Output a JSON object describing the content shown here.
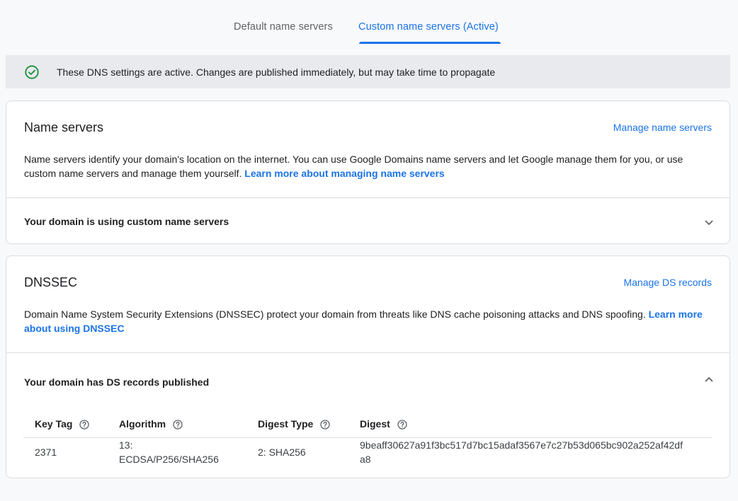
{
  "tabs": [
    {
      "label": "Default name servers"
    },
    {
      "label": "Custom name servers (Active)"
    }
  ],
  "banner": {
    "icon": "check-circle-icon",
    "color": "#1e8e3e",
    "message": "These DNS settings are active. Changes are published immediately, but may take time to propagate"
  },
  "name_servers": {
    "title": "Name servers",
    "manage_link": "Manage name servers",
    "description": "Name servers identify your domain's location on the internet. You can use Google Domains name servers and let Google manage them for you, or use custom name servers and manage them yourself.",
    "learn_more": "Learn more about managing name servers",
    "status": "Your domain is using custom name servers"
  },
  "dnssec": {
    "title": "DNSSEC",
    "manage_link": "Manage DS records",
    "description": "Domain Name System Security Extensions (DNSSEC) protect your domain from threats like DNS cache poisoning attacks and DNS spoofing.",
    "learn_more": "Learn more about using DNSSEC",
    "status": "Your domain has DS records published",
    "table": {
      "headers": [
        "Key Tag",
        "Algorithm",
        "Digest Type",
        "Digest"
      ],
      "rows": [
        {
          "key_tag": "2371",
          "algorithm_line1": "13:",
          "algorithm_line2": "ECDSA/P256/SHA256",
          "digest_type": "2: SHA256",
          "digest_line1": "9beaff30627a91f3bc517d7bc15adaf3567e7c27b53d065bc902a252af42df",
          "digest_line2": "a8"
        }
      ]
    }
  },
  "colors": {
    "accent": "#1a73e8",
    "success": "#1e8e3e"
  }
}
